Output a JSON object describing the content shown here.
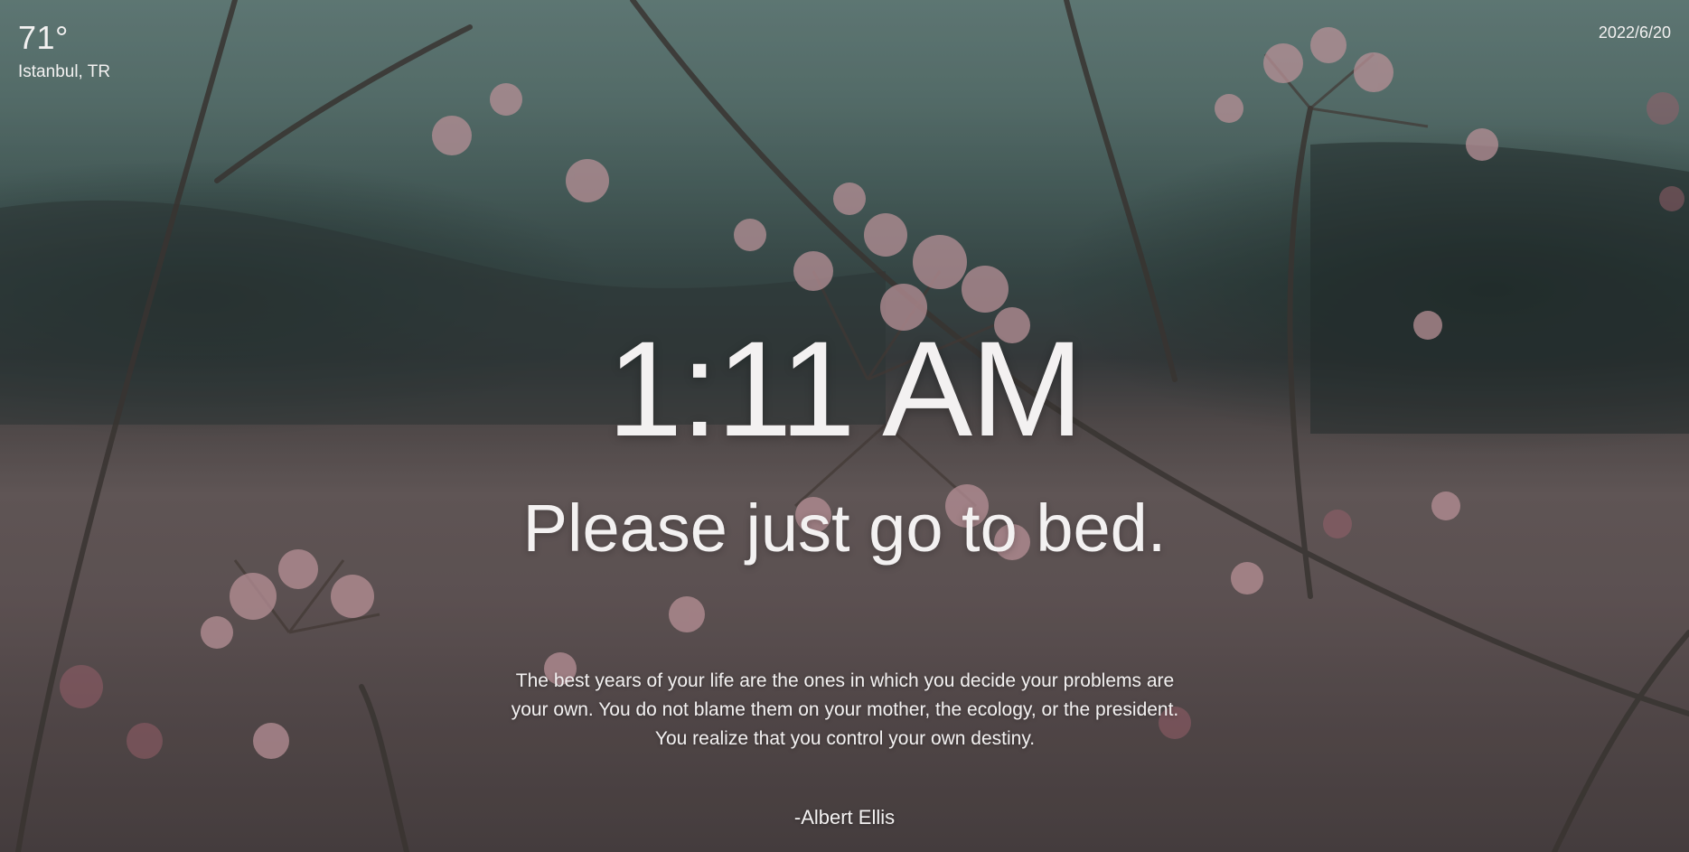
{
  "weather": {
    "temperature": "71°",
    "location": "Istanbul, TR"
  },
  "date": "2022/6/20",
  "clock": {
    "time": "1:11 AM"
  },
  "greeting": "Please just go to bed.",
  "quote": {
    "text": "The best years of your life are the ones in which you decide your problems are your own. You do not blame them on your mother, the ecology, or the president. You realize that you control your own destiny.",
    "author": "-Albert Ellis"
  },
  "background": {
    "description_colors": {
      "sky": "#6c8a86",
      "hills": "#3a4d4c",
      "ground": "#6e6262",
      "flowers": "#d8aeb4"
    }
  }
}
